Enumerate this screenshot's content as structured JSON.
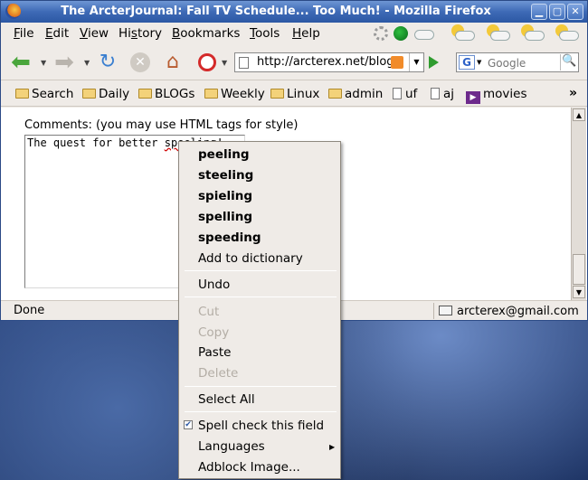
{
  "window": {
    "title": "The ArcterJournal: Fall TV Schedule... Too Much! - Mozilla Firefox"
  },
  "menubar": [
    {
      "pre": "",
      "u": "F",
      "post": "ile"
    },
    {
      "pre": "",
      "u": "E",
      "post": "dit"
    },
    {
      "pre": "",
      "u": "V",
      "post": "iew"
    },
    {
      "pre": "Hi",
      "u": "s",
      "post": "tory"
    },
    {
      "pre": "",
      "u": "B",
      "post": "ookmarks"
    },
    {
      "pre": "",
      "u": "T",
      "post": "ools"
    },
    {
      "pre": "",
      "u": "H",
      "post": "elp"
    }
  ],
  "nav": {
    "url": "http://arcterex.net/blog/",
    "search_placeholder": "Google",
    "search_engine_letter": "G"
  },
  "bookmarks": [
    "Search",
    "Daily",
    "BLOGs",
    "Weekly",
    "Linux",
    "admin",
    "uf",
    "aj",
    "movies"
  ],
  "content": {
    "comments_label": "Comments: (you may use HTML tags for style)",
    "text_before": "The quest for better ",
    "text_misspelled": "speeling!"
  },
  "status": {
    "text": "Done",
    "email": "arcterex@gmail.com"
  },
  "context_menu": {
    "suggestions": [
      "peeling",
      "steeling",
      "spieling",
      "spelling",
      "speeding"
    ],
    "add_to_dictionary": "Add to dictionary",
    "undo": "Undo",
    "cut": "Cut",
    "copy": "Copy",
    "paste": "Paste",
    "delete": "Delete",
    "select_all": "Select All",
    "spell_check": "Spell check this field",
    "languages": "Languages",
    "adblock": "Adblock Image..."
  },
  "colors": {
    "titlebar": "#3e6ab6",
    "misspelling": "#d00000",
    "chrome": "#efebe7"
  }
}
